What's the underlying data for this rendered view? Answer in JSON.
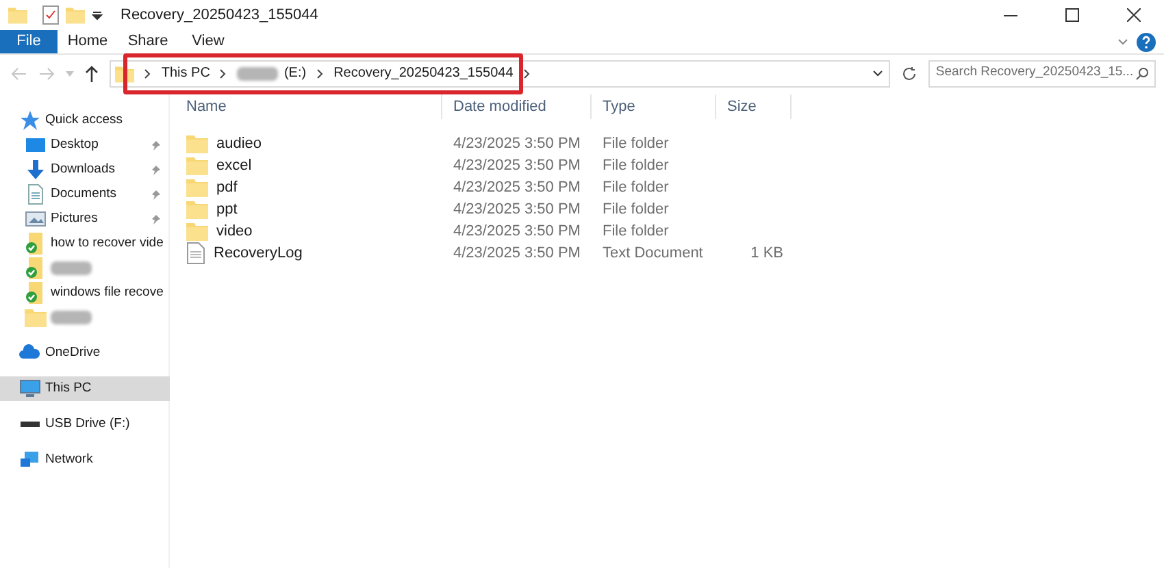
{
  "window": {
    "title": "Recovery_20250423_155044"
  },
  "ribbon_tabs": [
    {
      "label": "File",
      "selected": true
    },
    {
      "label": "Home",
      "selected": false
    },
    {
      "label": "Share",
      "selected": false
    },
    {
      "label": "View",
      "selected": false
    }
  ],
  "breadcrumb": [
    {
      "label": "This PC",
      "redacted": false
    },
    {
      "label": "(E:)",
      "redacted": true
    },
    {
      "label": "Recovery_20250423_155044",
      "redacted": false
    }
  ],
  "search": {
    "placeholder": "Search Recovery_20250423_15..."
  },
  "sidebar": {
    "items": [
      {
        "kind": "star",
        "label": "Quick access",
        "pinned": false,
        "selected": false,
        "redacted": false,
        "group": true
      },
      {
        "kind": "desktop",
        "label": "Desktop",
        "pinned": true,
        "selected": false,
        "redacted": false,
        "group": false
      },
      {
        "kind": "download",
        "label": "Downloads",
        "pinned": true,
        "selected": false,
        "redacted": false,
        "group": false
      },
      {
        "kind": "document",
        "label": "Documents",
        "pinned": true,
        "selected": false,
        "redacted": false,
        "group": false
      },
      {
        "kind": "pictures",
        "label": "Pictures",
        "pinned": true,
        "selected": false,
        "redacted": false,
        "group": false
      },
      {
        "kind": "synced",
        "label": "how to recover vide",
        "pinned": false,
        "selected": false,
        "redacted": false,
        "group": false
      },
      {
        "kind": "synced",
        "pinned": false,
        "selected": false,
        "redacted": true,
        "group": false
      },
      {
        "kind": "synced",
        "label": "windows file recove",
        "pinned": false,
        "selected": false,
        "redacted": false,
        "group": false
      },
      {
        "kind": "folder",
        "pinned": false,
        "selected": false,
        "redacted": true,
        "group": false
      },
      {
        "kind": "cloud",
        "label": "OneDrive",
        "pinned": false,
        "selected": false,
        "redacted": false,
        "group": true
      },
      {
        "kind": "pc",
        "label": "This PC",
        "pinned": false,
        "selected": true,
        "redacted": false,
        "group": true
      },
      {
        "kind": "usb",
        "label": "USB Drive (F:)",
        "pinned": false,
        "selected": false,
        "redacted": false,
        "group": true
      },
      {
        "kind": "network",
        "label": "Network",
        "pinned": false,
        "selected": false,
        "redacted": false,
        "group": true
      }
    ]
  },
  "table": {
    "columns": [
      "Name",
      "Date modified",
      "Type",
      "Size"
    ],
    "rows": [
      {
        "kind": "folder",
        "cells": [
          "audieo",
          "4/23/2025 3:50 PM",
          "File folder",
          ""
        ]
      },
      {
        "kind": "folder",
        "cells": [
          "excel",
          "4/23/2025 3:50 PM",
          "File folder",
          ""
        ]
      },
      {
        "kind": "folder",
        "cells": [
          "pdf",
          "4/23/2025 3:50 PM",
          "File folder",
          ""
        ]
      },
      {
        "kind": "folder",
        "cells": [
          "ppt",
          "4/23/2025 3:50 PM",
          "File folder",
          ""
        ]
      },
      {
        "kind": "folder",
        "cells": [
          "video",
          "4/23/2025 3:50 PM",
          "File folder",
          ""
        ]
      },
      {
        "kind": "text",
        "cells": [
          "RecoveryLog",
          "4/23/2025 3:50 PM",
          "Text Document",
          "1 KB"
        ]
      }
    ]
  }
}
